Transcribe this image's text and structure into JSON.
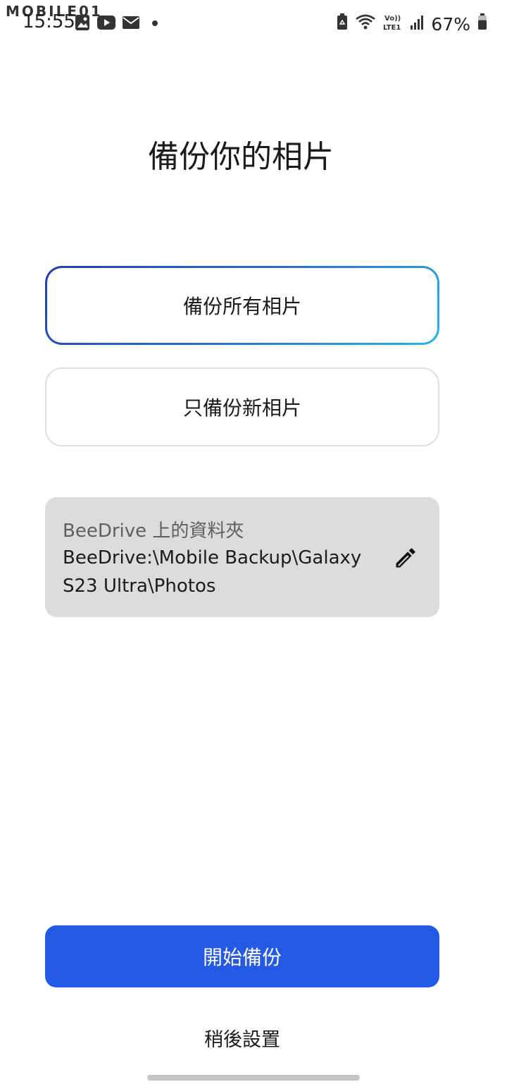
{
  "status_bar": {
    "watermark": "MOBILE01",
    "time": "15:55",
    "left_icons": [
      "gallery-icon",
      "youtube-icon",
      "mail-icon",
      "dot-icon"
    ],
    "right_icons": [
      "battery-saver-icon",
      "wifi-icon",
      "volte-icon",
      "signal-icon"
    ],
    "volte_text": "Vo)) LTE1",
    "battery_percent": "67%",
    "battery_level": 0.67
  },
  "main": {
    "title": "備份你的相片",
    "options": [
      {
        "label": "備份所有相片",
        "selected": true
      },
      {
        "label": "只備份新相片",
        "selected": false
      }
    ],
    "folder": {
      "label": "BeeDrive 上的資料夾",
      "path": "BeeDrive:\\Mobile Backup\\Galaxy S23 Ultra\\Photos",
      "edit_icon": "pencil-icon"
    },
    "primary_button": "開始備份",
    "secondary_link": "稍後設置"
  },
  "colors": {
    "primary": "#2459e6",
    "selected_border_start": "#1f3fb4",
    "selected_border_end": "#21b8e8",
    "folder_bg": "#dcdcdc"
  }
}
